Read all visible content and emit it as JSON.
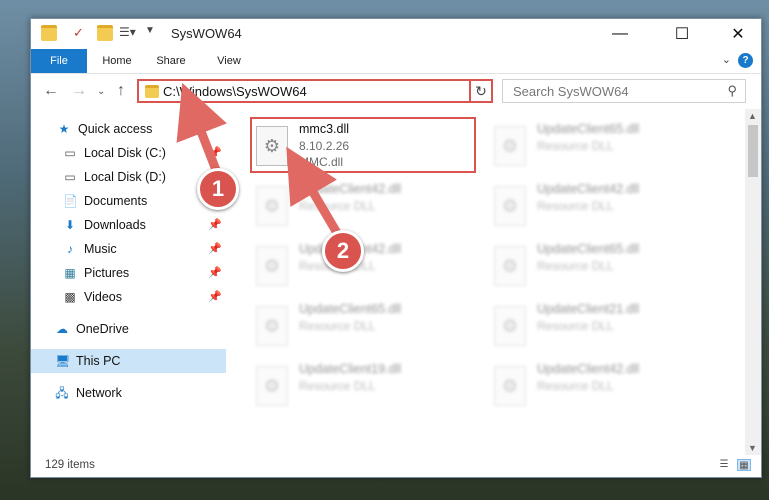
{
  "window": {
    "title": "SysWOW64"
  },
  "ribbon": {
    "tabs": [
      "File",
      "Home",
      "Share",
      "View"
    ]
  },
  "address": {
    "path": "C:\\Windows\\SysWOW64"
  },
  "search": {
    "placeholder": "Search SysWOW64"
  },
  "nav": {
    "items": [
      {
        "label": "Quick access",
        "icon": "star-icon"
      },
      {
        "label": "Local Disk (C:)",
        "icon": "drive-icon"
      },
      {
        "label": "Local Disk (D:)",
        "icon": "drive-icon"
      },
      {
        "label": "Documents",
        "icon": "documents-icon"
      },
      {
        "label": "Downloads",
        "icon": "download-icon"
      },
      {
        "label": "Music",
        "icon": "music-icon"
      },
      {
        "label": "Pictures",
        "icon": "pictures-icon"
      },
      {
        "label": "Videos",
        "icon": "videos-icon"
      },
      {
        "label": "OneDrive",
        "icon": "cloud-icon"
      },
      {
        "label": "This PC",
        "icon": "computer-icon"
      },
      {
        "label": "Network",
        "icon": "network-icon"
      }
    ]
  },
  "files": [
    {
      "name": "mmc3.dll",
      "line2": "8.10.2.26",
      "line3": "MMC.dll"
    },
    {
      "name": "UpdateClient65.dll",
      "line2": "Resource DLL"
    },
    {
      "name": "UpdateClient42.dll",
      "line2": "Resource DLL"
    },
    {
      "name": "UpdateClient42.dll",
      "line2": "Resource DLL"
    },
    {
      "name": "UpdateClient42.dll",
      "line2": "Resource DLL"
    },
    {
      "name": "UpdateClient65.dll",
      "line2": "Resource DLL"
    },
    {
      "name": "UpdateClient65.dll",
      "line2": "Resource DLL"
    },
    {
      "name": "UpdateClient21.dll",
      "line2": "Resource DLL"
    },
    {
      "name": "UpdateClient19.dll",
      "line2": "Resource DLL"
    },
    {
      "name": "UpdateClient42.dll",
      "line2": "Resource DLL"
    }
  ],
  "status": {
    "count": "129 items"
  },
  "callouts": [
    "1",
    "2"
  ],
  "colors": {
    "accent": "#1979ca",
    "highlight": "#d9534f"
  }
}
